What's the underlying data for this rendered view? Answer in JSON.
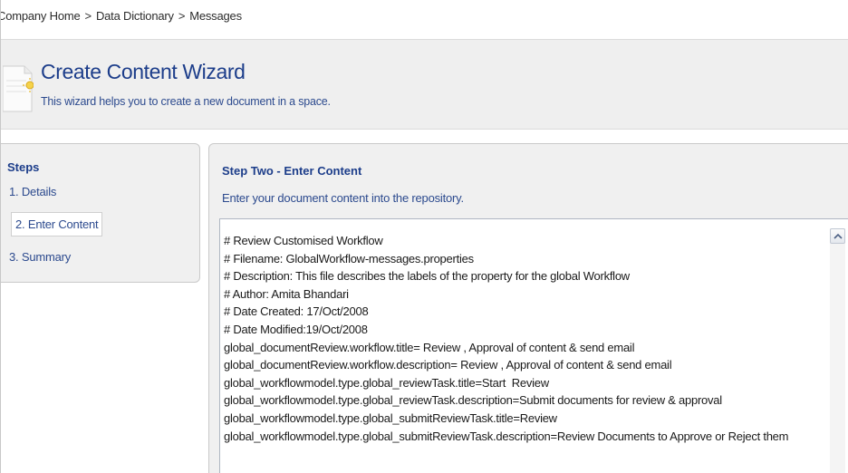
{
  "breadcrumb": {
    "items": [
      "Company Home",
      "Data Dictionary",
      "Messages"
    ],
    "separator": ">"
  },
  "header": {
    "title": "Create Content Wizard",
    "description": "This wizard helps you to create a new document in a space.",
    "icon": "wizard-document-icon"
  },
  "steps": {
    "title": "Steps",
    "items": [
      "1. Details",
      "2. Enter Content",
      "3. Summary"
    ],
    "selected_index": 1
  },
  "content": {
    "title": "Step Two - Enter Content",
    "description": "Enter your document content into the repository.",
    "editor_lines": [
      "# Review Customised Workflow",
      "# Filename: GlobalWorkflow-messages.properties",
      "# Description: This file describes the labels of the property for the global Workflow",
      "# Author: Amita Bhandari",
      "# Date Created: 17/Oct/2008",
      "# Date Modified:19/Oct/2008",
      "global_documentReview.workflow.title= Review , Approval of content & send email",
      "global_documentReview.workflow.description= Review , Approval of content & send email",
      "global_workflowmodel.type.global_reviewTask.title=Start  Review",
      "global_workflowmodel.type.global_reviewTask.description=Submit documents for review & approval",
      "global_workflowmodel.type.global_submitReviewTask.title=Review",
      "global_workflowmodel.type.global_submitReviewTask.description=Review Documents to Approve or Reject them"
    ]
  },
  "colors": {
    "title_blue": "#1c3d8a",
    "text_blue": "#2c4a8e",
    "panel_bg": "#f0f0f0"
  }
}
